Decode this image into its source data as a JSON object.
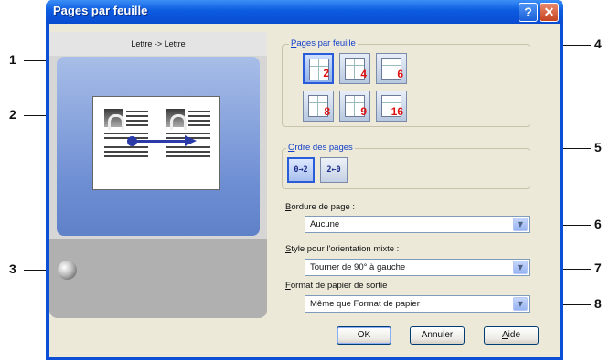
{
  "window": {
    "title": "Pages par feuille",
    "help_glyph": "?",
    "close_glyph": "✕"
  },
  "preview": {
    "caption": "Lettre -> Lettre"
  },
  "pages_per_sheet": {
    "label_accel": "P",
    "label_rest": "ages par feuille",
    "options": [
      "2",
      "4",
      "6",
      "8",
      "9",
      "16"
    ],
    "selected": "2"
  },
  "page_order": {
    "label_accel": "O",
    "label_rest": "rdre des pages",
    "options": [
      "0→2",
      "2←0"
    ],
    "selected": "0→2"
  },
  "page_border": {
    "label_accel": "B",
    "label_rest": "ordure de page :",
    "value": "Aucune"
  },
  "mixed_orientation": {
    "label_accel": "S",
    "label_rest": "tyle pour l'orientation mixte :",
    "value": "Tourner de 90° à gauche"
  },
  "output_paper": {
    "label_accel": "F",
    "label_rest": "ormat de papier de sortie :",
    "value": "Même que Format de papier"
  },
  "buttons": {
    "ok": "OK",
    "cancel": "Annuler",
    "help_accel": "A",
    "help_rest": "ide"
  },
  "callouts": [
    "1",
    "2",
    "3",
    "4",
    "5",
    "6",
    "7",
    "8"
  ]
}
